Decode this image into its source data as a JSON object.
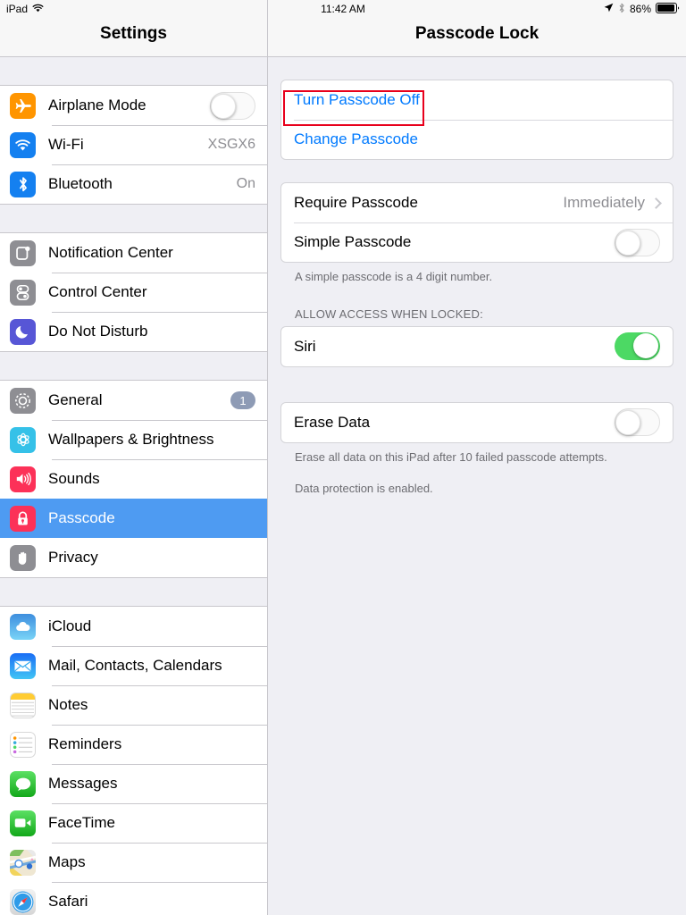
{
  "status_bar": {
    "device": "iPad",
    "wifi_icon": "wifi-icon",
    "time": "11:42 AM",
    "location_icon": "location-arrow-icon",
    "bluetooth_icon": "bluetooth-icon",
    "battery_percent": "86%",
    "battery_icon": "battery-icon"
  },
  "sidebar": {
    "title": "Settings",
    "groups": [
      {
        "items": [
          {
            "label": "Airplane Mode",
            "icon": "airplane-icon",
            "accessory": "toggle",
            "toggle_on": false
          },
          {
            "label": "Wi-Fi",
            "icon": "wifi-icon",
            "accessory": "value",
            "value": "XSGX6"
          },
          {
            "label": "Bluetooth",
            "icon": "bluetooth-icon",
            "accessory": "value",
            "value": "On"
          }
        ]
      },
      {
        "items": [
          {
            "label": "Notification Center",
            "icon": "notification-center-icon",
            "accessory": "none"
          },
          {
            "label": "Control Center",
            "icon": "control-center-icon",
            "accessory": "none"
          },
          {
            "label": "Do Not Disturb",
            "icon": "moon-icon",
            "accessory": "none"
          }
        ]
      },
      {
        "items": [
          {
            "label": "General",
            "icon": "gear-icon",
            "accessory": "badge",
            "badge": "1"
          },
          {
            "label": "Wallpapers & Brightness",
            "icon": "wallpaper-icon",
            "accessory": "none"
          },
          {
            "label": "Sounds",
            "icon": "speaker-icon",
            "accessory": "none"
          },
          {
            "label": "Passcode",
            "icon": "lock-icon",
            "accessory": "none",
            "selected": true
          },
          {
            "label": "Privacy",
            "icon": "hand-icon",
            "accessory": "none"
          }
        ]
      },
      {
        "items": [
          {
            "label": "iCloud",
            "icon": "cloud-icon",
            "accessory": "none"
          },
          {
            "label": "Mail, Contacts, Calendars",
            "icon": "envelope-icon",
            "accessory": "none"
          },
          {
            "label": "Notes",
            "icon": "notes-icon",
            "accessory": "none"
          },
          {
            "label": "Reminders",
            "icon": "reminders-icon",
            "accessory": "none"
          },
          {
            "label": "Messages",
            "icon": "message-bubble-icon",
            "accessory": "none"
          },
          {
            "label": "FaceTime",
            "icon": "video-camera-icon",
            "accessory": "none"
          },
          {
            "label": "Maps",
            "icon": "maps-icon",
            "accessory": "none"
          },
          {
            "label": "Safari",
            "icon": "compass-icon",
            "accessory": "none"
          }
        ]
      }
    ]
  },
  "detail": {
    "title": "Passcode Lock",
    "actions": {
      "turn_passcode_off": "Turn Passcode Off",
      "change_passcode": "Change Passcode"
    },
    "options": {
      "require_passcode_label": "Require Passcode",
      "require_passcode_value": "Immediately",
      "simple_passcode_label": "Simple Passcode",
      "simple_passcode_on": false,
      "simple_passcode_footnote": "A simple passcode is a 4 digit number."
    },
    "allow_access": {
      "header": "ALLOW ACCESS WHEN LOCKED:",
      "siri_label": "Siri",
      "siri_on": true
    },
    "erase": {
      "label": "Erase Data",
      "toggle_on": false,
      "footnote": "Erase all data on this iPad after 10 failed passcode attempts.",
      "footnote_secondary": "Data protection is enabled."
    }
  },
  "annotation": {
    "target": "Turn Passcode Off",
    "color": "#E8001C"
  },
  "colors": {
    "selection_blue": "#4E9BF2",
    "link_blue": "#007AFF",
    "toggle_green": "#4CD964",
    "background": "#EFEFF4",
    "separator": "#C8C7CC"
  }
}
